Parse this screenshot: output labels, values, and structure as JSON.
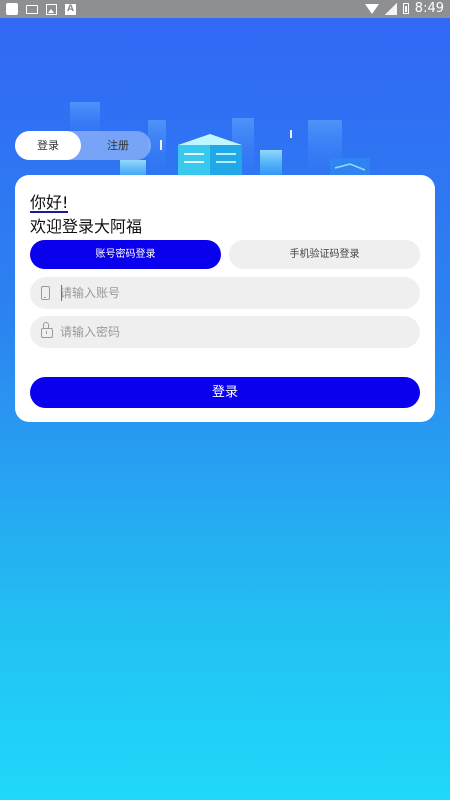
{
  "status_bar": {
    "time": "8:49",
    "left_icons": [
      "app-icon",
      "keyboard-icon",
      "image-icon",
      "a-icon"
    ],
    "right_icons": [
      "wifi-icon",
      "signal-icon",
      "battery-icon"
    ],
    "a_icon_letter": "A"
  },
  "tabs": {
    "login": "登录",
    "register": "注册"
  },
  "card": {
    "greeting": "你好!",
    "welcome": "欢迎登录大阿福",
    "mode_password": "账号密码登录",
    "mode_sms": "手机验证码登录",
    "account_placeholder": "请输入账号",
    "password_placeholder": "请输入密码",
    "submit": "登录"
  },
  "colors": {
    "gradient_top": "#3266f6",
    "gradient_bottom": "#1fd8fa",
    "accent": "#0a00ee"
  }
}
